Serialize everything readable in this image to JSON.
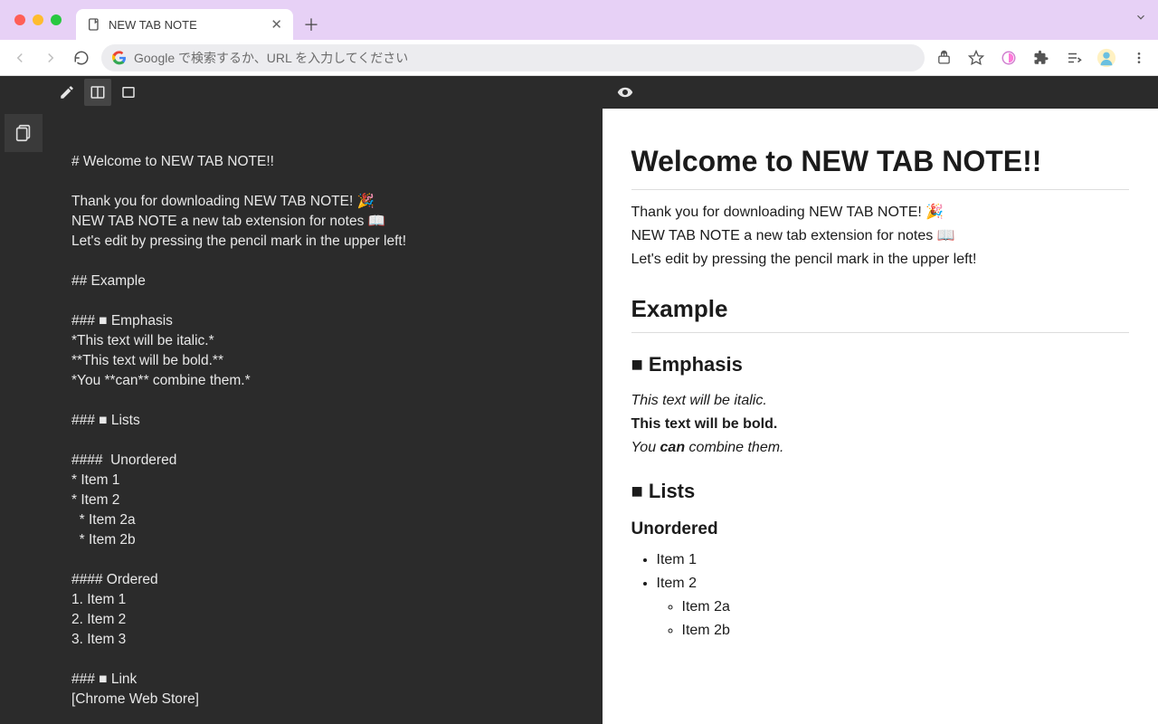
{
  "browser": {
    "tab_title": "NEW TAB NOTE",
    "omnibox_placeholder": "Google で検索するか、URL を入力してください"
  },
  "editor_text": "# Welcome to NEW TAB NOTE!!\n\nThank you for downloading NEW TAB NOTE! 🎉\nNEW TAB NOTE a new tab extension for notes 📖\nLet's edit by pressing the pencil mark in the upper left!\n\n## Example\n\n### ■ Emphasis\n*This text will be italic.*\n**This text will be bold.**\n*You **can** combine them.*\n\n### ■ Lists\n\n####  Unordered\n* Item 1\n* Item 2\n  * Item 2a\n  * Item 2b\n\n#### Ordered\n1. Item 1\n2. Item 2\n3. Item 3\n\n### ■ Link\n[Chrome Web Store]",
  "preview": {
    "h1": "Welcome to NEW TAB NOTE!!",
    "intro_l1": "Thank you for downloading NEW TAB NOTE! 🎉",
    "intro_l2": "NEW TAB NOTE a new tab extension for notes 📖",
    "intro_l3": "Let's edit by pressing the pencil mark in the upper left!",
    "h2_example": "Example",
    "h3_emphasis": "■ Emphasis",
    "em_italic": "This text will be italic.",
    "em_bold": "This text will be bold.",
    "em_combine_pre": "You ",
    "em_combine_strong": "can",
    "em_combine_post": " combine them.",
    "h3_lists": "■ Lists",
    "h4_unordered": "Unordered",
    "ul_item1": "Item 1",
    "ul_item2": "Item 2",
    "ul_item2a": "Item 2a",
    "ul_item2b": "Item 2b"
  }
}
